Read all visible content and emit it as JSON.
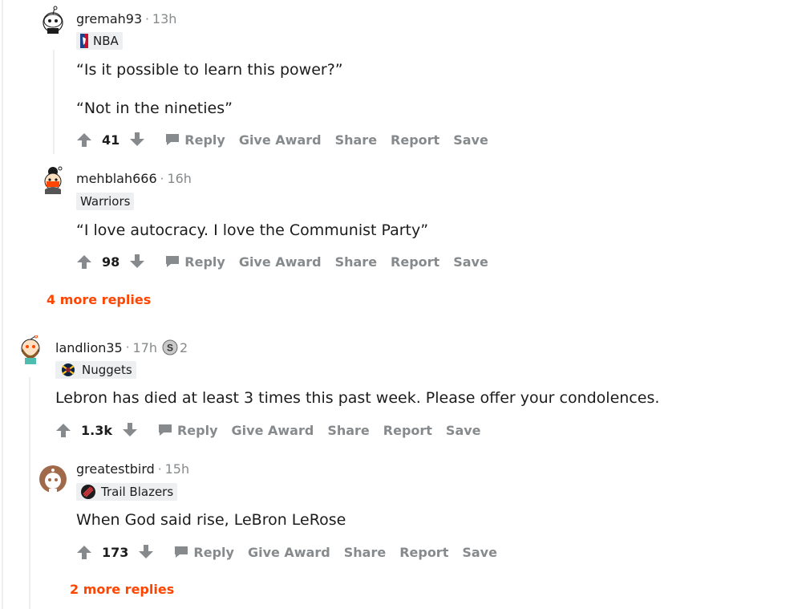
{
  "colors": {
    "accent": "#ff4500",
    "muted": "#878a8c",
    "flair_bg": "#edeff1"
  },
  "comments": [
    {
      "username": "gremah93",
      "time": "13h",
      "flair": {
        "label": "NBA",
        "icon": "nba-logo-icon"
      },
      "body": [
        "“Is it possible to learn this power?”",
        "“Not in the nineties”"
      ],
      "score": "41"
    },
    {
      "username": "mehblah666",
      "time": "16h",
      "flair": {
        "label": "Warriors"
      },
      "body": [
        "“I love autocracy. I love the Communist Party”"
      ],
      "score": "98"
    },
    {
      "username": "landlion35",
      "time": "17h",
      "award": {
        "icon": "silver-award-icon",
        "count": "2"
      },
      "flair": {
        "label": "Nuggets",
        "icon": "nuggets-logo-icon"
      },
      "body": [
        "Lebron has died at least 3 times this past week. Please offer your condolences."
      ],
      "score": "1.3k"
    },
    {
      "username": "greatestbird",
      "time": "15h",
      "flair": {
        "label": "Trail Blazers",
        "icon": "trail-blazers-logo-icon"
      },
      "body": [
        "When God said rise, LeBron LeRose"
      ],
      "score": "173"
    }
  ],
  "actions": {
    "reply": "Reply",
    "give_award": "Give Award",
    "share": "Share",
    "report": "Report",
    "save": "Save"
  },
  "more_replies": [
    "4 more replies",
    "2 more replies"
  ],
  "separator": "·"
}
